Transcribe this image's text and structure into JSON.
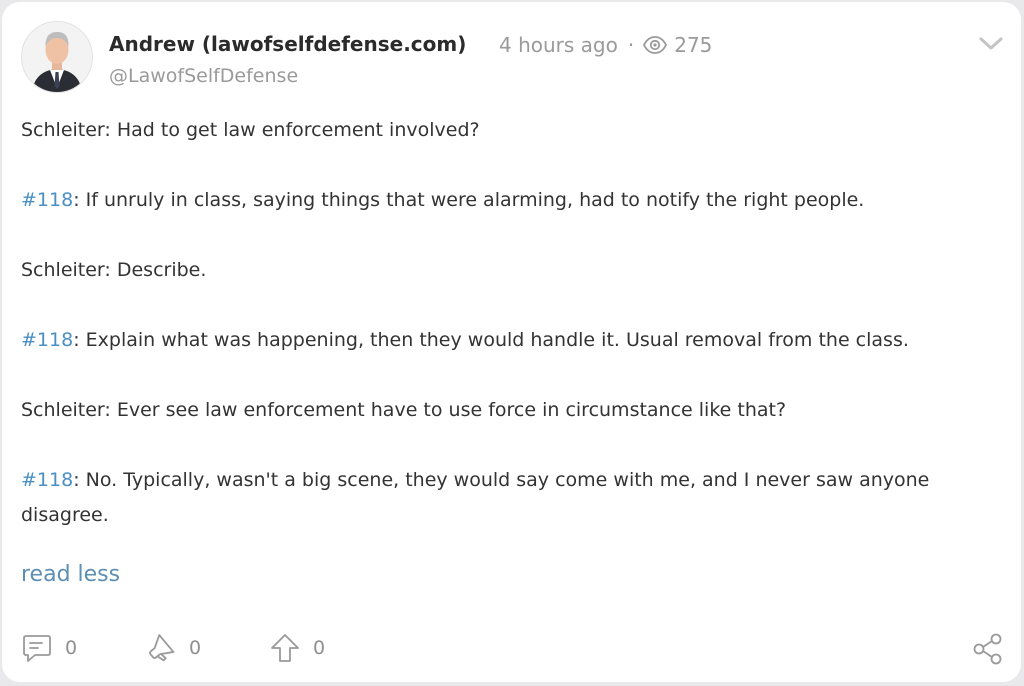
{
  "post": {
    "author_name": "Andrew (lawofselfdefense.com)",
    "time_ago": "4 hours ago",
    "separator": "·",
    "views": "275",
    "handle": "@LawofSelfDefense",
    "paragraphs": [
      {
        "tag": "",
        "text": "Schleiter: Had to get law enforcement involved?"
      },
      {
        "tag": "#118",
        "text": ": If unruly in class, saying things that were alarming, had to notify the right people."
      },
      {
        "tag": "",
        "text": "Schleiter: Describe."
      },
      {
        "tag": "#118",
        "text": ": Explain what was happening, then they would handle it. Usual removal from the class."
      },
      {
        "tag": "",
        "text": "Schleiter: Ever see law enforcement have to use force in circumstance like that?"
      },
      {
        "tag": "#118",
        "text": ": No. Typically, wasn't a big scene, they would say come with me, and I never saw anyone disagree."
      }
    ],
    "read_less": "read less"
  },
  "actions": {
    "comments": {
      "icon": "comment-icon",
      "count": "0"
    },
    "reposts": {
      "icon": "megaphone-icon",
      "count": "0"
    },
    "upvotes": {
      "icon": "upvote-icon",
      "count": "0"
    },
    "share": {
      "icon": "share-icon"
    }
  },
  "colors": {
    "link": "#4a8fc4",
    "read_less": "#5d8fb4",
    "muted": "#9a9a9a",
    "text": "#333333"
  }
}
